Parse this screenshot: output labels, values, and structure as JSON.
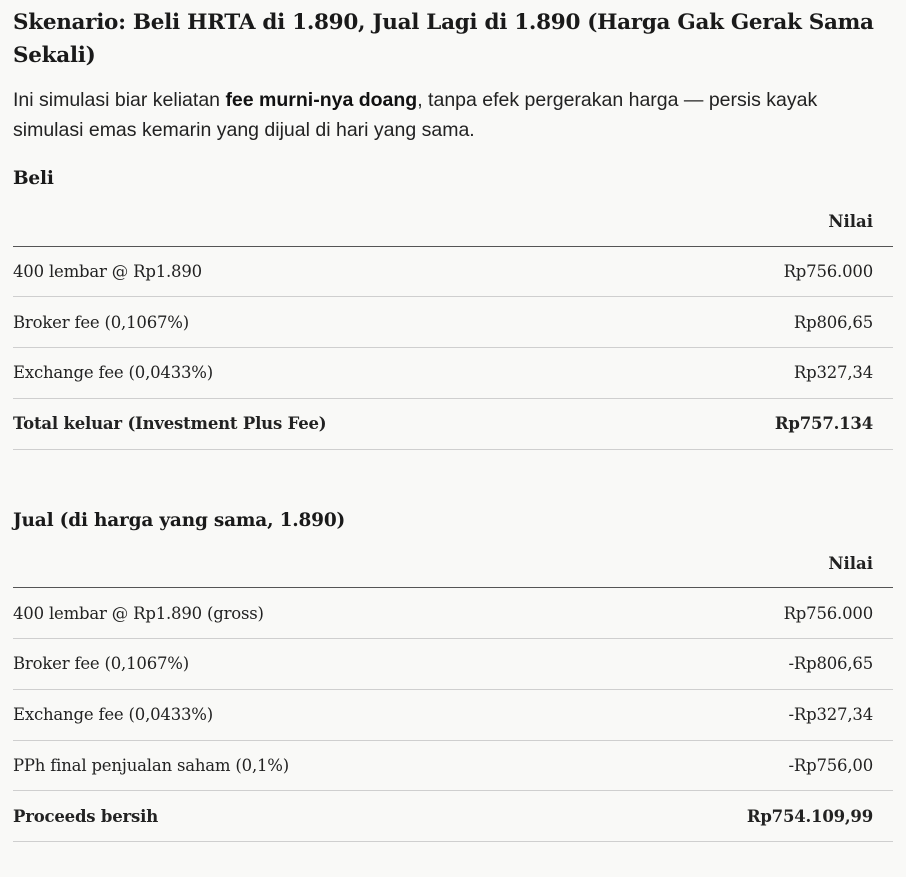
{
  "heading": {
    "title": "Skenario: Beli HRTA di 1.890, Jual Lagi di 1.890 (Harga Gak Gerak Sama Sekali)"
  },
  "intro": {
    "prefix": "Ini simulasi biar keliatan ",
    "bold": "fee murni-nya doang",
    "suffix": ", tanpa efek pergerakan harga — persis kayak simulasi emas kemarin yang dijual di hari yang sama."
  },
  "beli": {
    "heading": "Beli",
    "columns": [
      "",
      "Nilai"
    ],
    "rows": [
      {
        "label": "400 lembar @ Rp1.890",
        "value": "Rp756.000"
      },
      {
        "label": "Broker fee (0,1067%)",
        "value": "Rp806,65"
      },
      {
        "label": "Exchange fee (0,0433%)",
        "value": "Rp327,34"
      },
      {
        "label": "Total keluar (Investment Plus Fee)",
        "value": "Rp757.134"
      }
    ]
  },
  "jual": {
    "heading": "Jual (di harga yang sama, 1.890)",
    "columns": [
      "",
      "Nilai"
    ],
    "rows": [
      {
        "label": "400 lembar @ Rp1.890 (gross)",
        "value": "Rp756.000"
      },
      {
        "label": "Broker fee (0,1067%)",
        "value": "-Rp806,65"
      },
      {
        "label": "Exchange fee (0,0433%)",
        "value": "-Rp327,34"
      },
      {
        "label": "PPh final penjualan saham (0,1%)",
        "value": "-Rp756,00"
      },
      {
        "label": "Proceeds bersih",
        "value": "Rp754.109,99"
      }
    ]
  }
}
